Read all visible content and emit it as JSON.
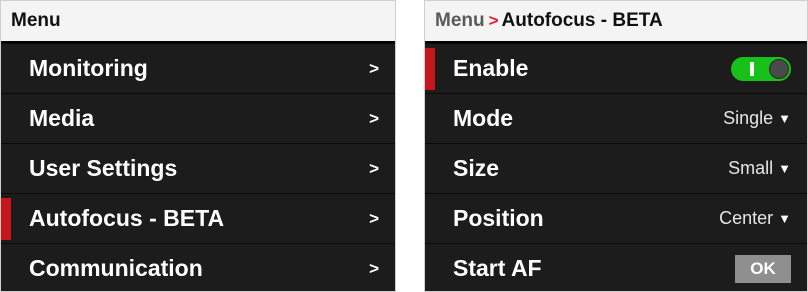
{
  "menu_panel": {
    "title": "Menu",
    "items": [
      {
        "label": "Monitoring",
        "chevron": ">"
      },
      {
        "label": "Media",
        "chevron": ">"
      },
      {
        "label": "User Settings",
        "chevron": ">"
      },
      {
        "label": "Autofocus - BETA",
        "chevron": ">",
        "selected": true
      },
      {
        "label": "Communication",
        "chevron": ">"
      }
    ]
  },
  "autofocus_panel": {
    "breadcrumb": {
      "root": "Menu",
      "separator": ">",
      "current": "Autofocus - BETA"
    },
    "enable": {
      "label": "Enable",
      "toggle_on": true,
      "toggle_mark": "I"
    },
    "mode": {
      "label": "Mode",
      "value": "Single",
      "arrow": "▼"
    },
    "size": {
      "label": "Size",
      "value": "Small",
      "arrow": "▼"
    },
    "position": {
      "label": "Position",
      "value": "Center",
      "arrow": "▼"
    },
    "start_af": {
      "label": "Start AF",
      "button": "OK"
    }
  },
  "colors": {
    "selection_accent": "#c4161c",
    "toggle_on": "#17c11a",
    "panel_bg": "#1c1c1c",
    "header_bg": "#f4f4f4"
  },
  "icons": {
    "chevron": "chevron-right-icon",
    "dropdown": "dropdown-arrow-icon"
  }
}
